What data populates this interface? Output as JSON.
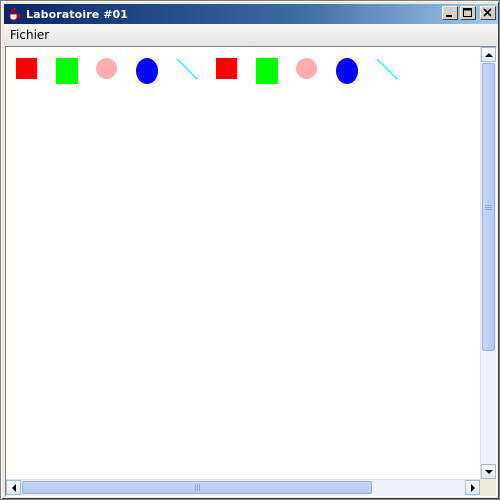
{
  "window": {
    "title": "Laboratoire #01",
    "icon": "java-cup-icon",
    "buttons": {
      "minimize": "_",
      "maximize": "□",
      "close": "X"
    }
  },
  "menubar": {
    "items": [
      {
        "label": "Fichier"
      }
    ]
  },
  "canvas": {
    "background": "#ffffff",
    "shapes": [
      {
        "type": "square",
        "color": "#ff0000"
      },
      {
        "type": "rectangle",
        "color": "#00ff00"
      },
      {
        "type": "circle",
        "color": "#ffafaf"
      },
      {
        "type": "ellipse",
        "color": "#0000ff"
      },
      {
        "type": "line",
        "color": "#00ffff"
      },
      {
        "type": "square",
        "color": "#ff0000"
      },
      {
        "type": "rectangle",
        "color": "#00ff00"
      },
      {
        "type": "circle",
        "color": "#ffafaf"
      },
      {
        "type": "ellipse",
        "color": "#0000ff"
      },
      {
        "type": "line",
        "color": "#00ffff"
      }
    ]
  },
  "scrollbars": {
    "vertical": {
      "up_icon": "arrow-up-icon",
      "down_icon": "arrow-down-icon"
    },
    "horizontal": {
      "left_icon": "arrow-left-icon",
      "right_icon": "arrow-right-icon"
    }
  }
}
